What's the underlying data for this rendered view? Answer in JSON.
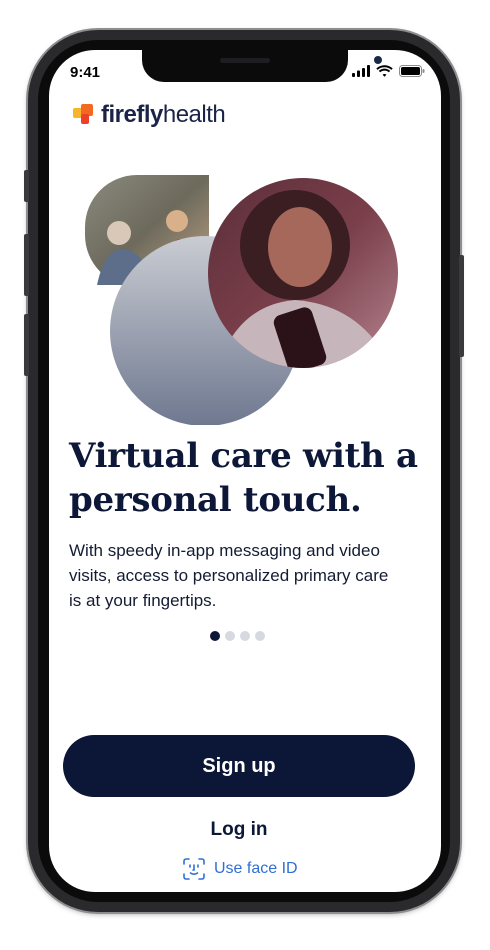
{
  "status_bar": {
    "time": "9:41"
  },
  "brand": {
    "logo_bold": "firefly",
    "logo_light": "health"
  },
  "onboarding": {
    "headline_line1": "Virtual care with a",
    "headline_line2": "personal touch.",
    "body_line1": "With speedy in-app messaging and video",
    "body_line2": "visits, access to personalized primary care",
    "body_line3": "is at your fingertips.",
    "page_index": 1,
    "page_count": 4
  },
  "actions": {
    "signup_label": "Sign up",
    "login_label": "Log in",
    "faceid_label": "Use face ID"
  },
  "icons": [
    "signal-icon",
    "wifi-icon",
    "battery-icon",
    "firefly-logo-icon",
    "face-id-icon"
  ],
  "colors": {
    "brand_navy": "#0c1636",
    "link_blue": "#2f6fd6",
    "logo_orange": "#f26a21",
    "logo_yellow": "#f7b52b",
    "dot_inactive": "#d6d9df"
  }
}
